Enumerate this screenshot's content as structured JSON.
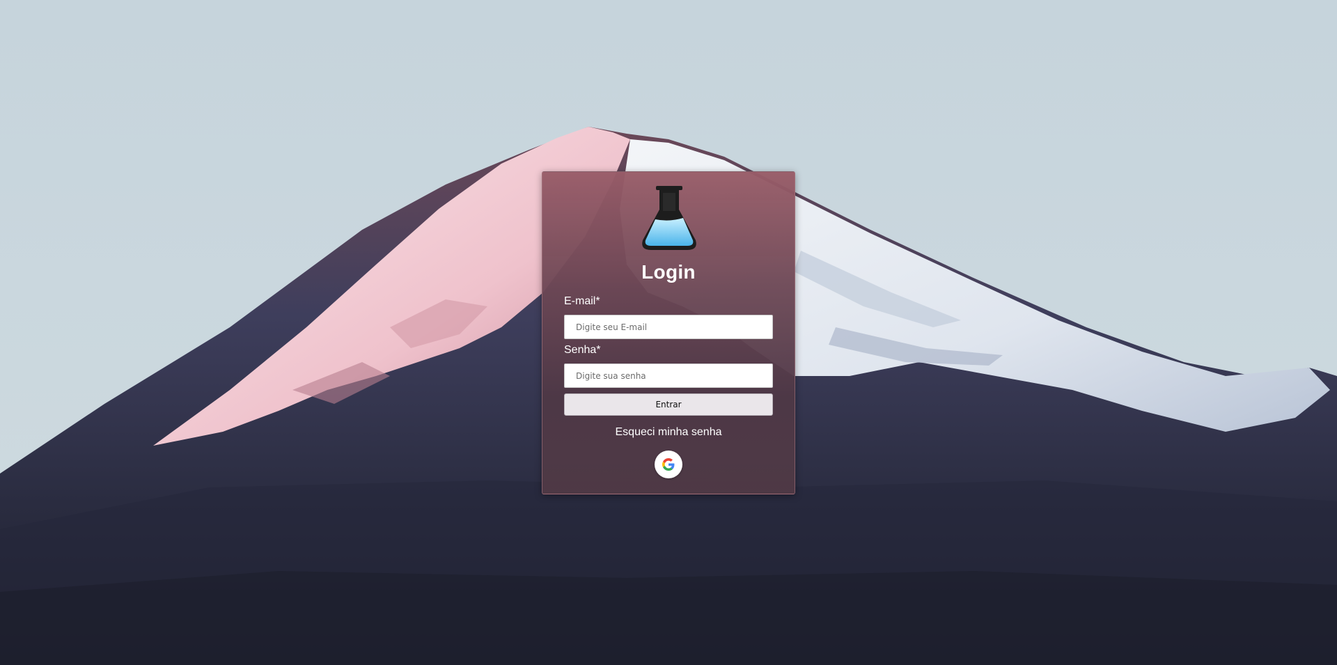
{
  "background": {
    "image": "mountain-icon",
    "sky_color": "#c9d6dd"
  },
  "login": {
    "logo": "flask-icon",
    "title": "Login",
    "email_label": "E-mail*",
    "email_placeholder": "Digite seu E-mail",
    "email_value": "",
    "password_label": "Senha*",
    "password_placeholder": "Digite sua senha",
    "password_value": "",
    "submit_label": "Entrar",
    "forgot_label": "Esqueci minha senha",
    "google_icon": "google-icon"
  },
  "colors": {
    "card_top": "#985c68",
    "card_bottom": "#503a46",
    "button_bg": "#eae6ea"
  }
}
